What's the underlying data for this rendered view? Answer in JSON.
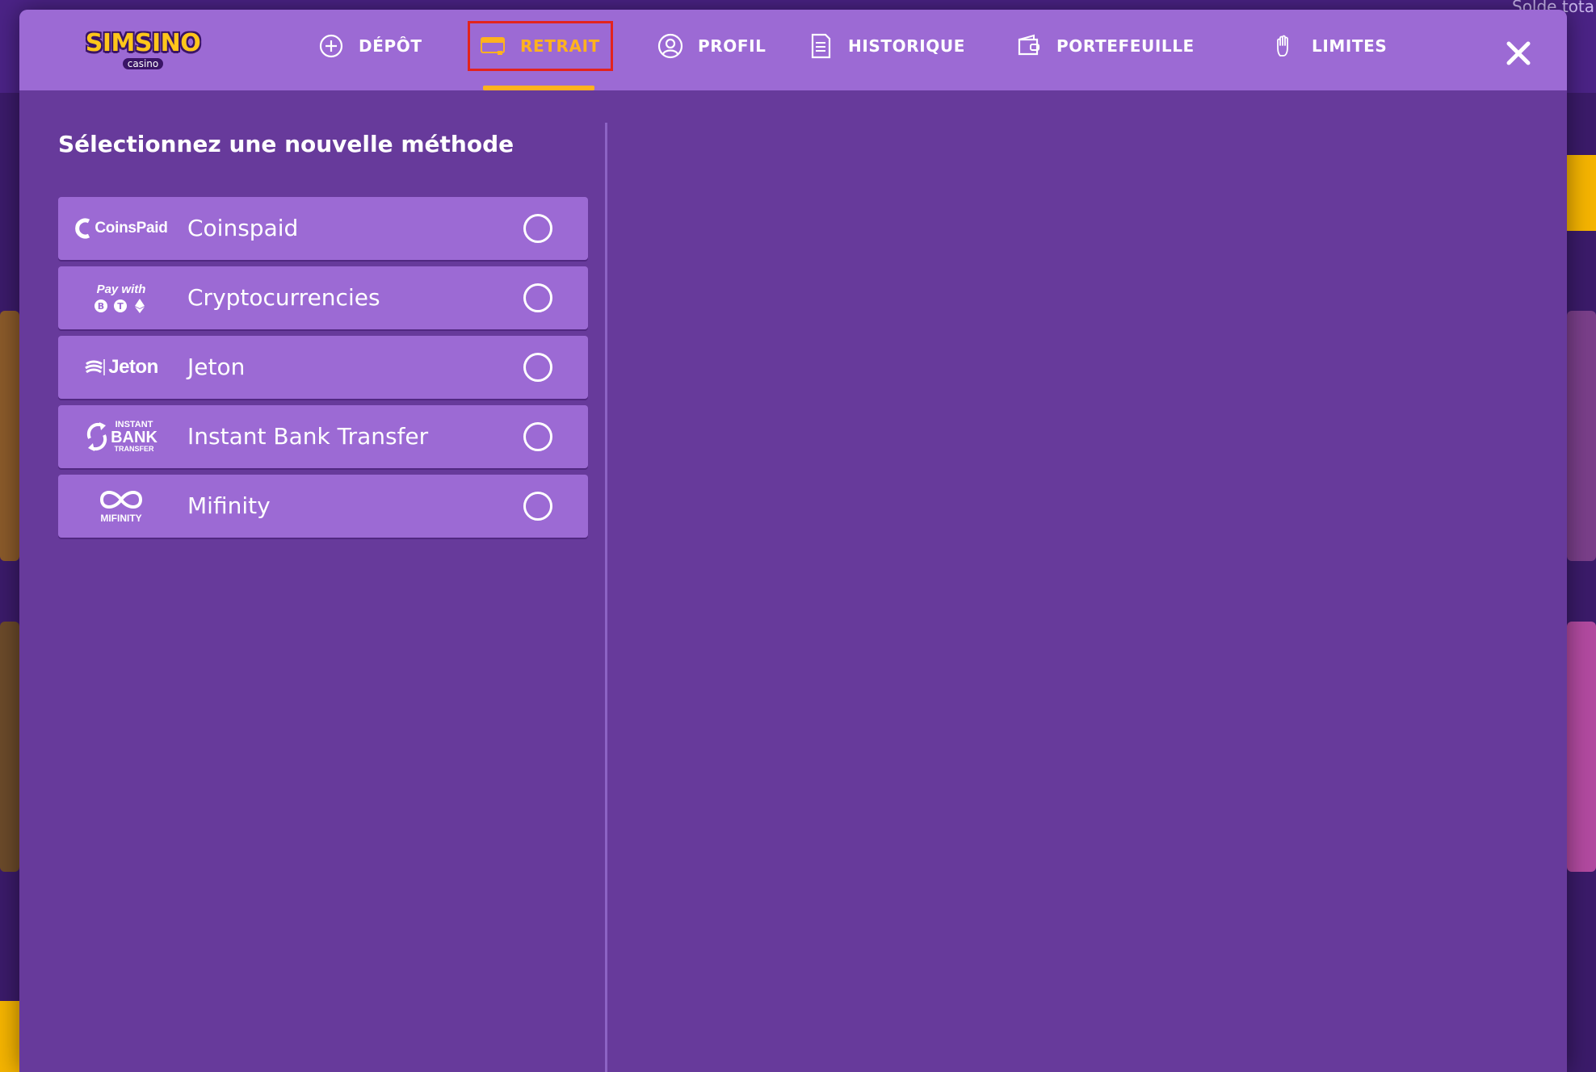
{
  "header": {
    "logo": {
      "name": "SIMSINO",
      "sub": "casino"
    },
    "tabs": [
      {
        "id": "depot",
        "label": "DÉPÔT",
        "icon": "plus-circle-icon",
        "active": false
      },
      {
        "id": "retrait",
        "label": "RETRAIT",
        "icon": "card-icon",
        "active": true
      },
      {
        "id": "profil",
        "label": "PROFIL",
        "icon": "user-circle-icon",
        "active": false
      },
      {
        "id": "historique",
        "label": "HISTORIQUE",
        "icon": "document-icon",
        "active": false
      },
      {
        "id": "portefeuille",
        "label": "PORTEFEUILLE",
        "icon": "wallet-icon",
        "active": false
      },
      {
        "id": "limites",
        "label": "LIMITES",
        "icon": "hand-icon",
        "active": false
      }
    ],
    "close_icon": "close-icon"
  },
  "main": {
    "title": "Sélectionnez une nouvelle méthode",
    "methods": [
      {
        "label": "Coinspaid",
        "logo_text": "CoinsPaid",
        "selected": false
      },
      {
        "label": "Cryptocurrencies",
        "logo_text": "Pay with",
        "selected": false
      },
      {
        "label": "Jeton",
        "logo_text": "Jeton",
        "selected": false
      },
      {
        "label": "Instant Bank Transfer",
        "logo_text": [
          "INSTANT",
          "BANK",
          "TRANSFER"
        ],
        "selected": false
      },
      {
        "label": "Mifinity",
        "logo_text": "MIFINITY",
        "selected": false
      }
    ]
  },
  "background": {
    "top_right_text": "Solde tota"
  },
  "colors": {
    "header": "#9c6ad4",
    "panel": "#673a9b",
    "accent": "#ffb21e",
    "highlight_outline": "#e3231d"
  }
}
